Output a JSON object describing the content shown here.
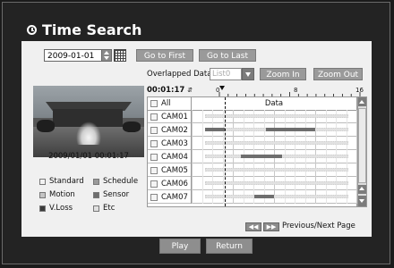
{
  "title": "Time Search",
  "date": {
    "value": "2009-01-01"
  },
  "buttons": {
    "go_first": "Go to First",
    "go_last": "Go to Last",
    "zoom_in": "Zoom In",
    "zoom_out": "Zoom Out",
    "play": "Play",
    "return": "Return"
  },
  "overlapped": {
    "label": "Overlapped Data",
    "selected": "List0"
  },
  "preview": {
    "timestamp": "2009/01/01  00:01:17"
  },
  "legend": [
    {
      "label": "Standard",
      "color": "#f2f2f2"
    },
    {
      "label": "Schedule",
      "color": "#9a9a9a"
    },
    {
      "label": "Motion",
      "color": "#c4c4c4"
    },
    {
      "label": "Sensor",
      "color": "#6e6e6e"
    },
    {
      "label": "V.Loss",
      "color": "#3a3a3a"
    },
    {
      "label": "Etc",
      "color": "#e0e0e0"
    }
  ],
  "timeline": {
    "current_time": "00:01:17",
    "ticks": [
      "0",
      "8",
      "16"
    ]
  },
  "table": {
    "all_label": "All",
    "data_header": "Data"
  },
  "cameras": [
    {
      "name": "CAM01",
      "segments": [
        [
          0.08,
          0.95
        ]
      ],
      "dark": []
    },
    {
      "name": "CAM02",
      "segments": [
        [
          0.08,
          0.95
        ]
      ],
      "dark": [
        [
          0.08,
          0.2
        ],
        [
          0.45,
          0.75
        ]
      ]
    },
    {
      "name": "CAM03",
      "segments": [
        [
          0.08,
          0.95
        ]
      ],
      "dark": []
    },
    {
      "name": "CAM04",
      "segments": [
        [
          0.08,
          0.95
        ]
      ],
      "dark": [
        [
          0.3,
          0.55
        ]
      ]
    },
    {
      "name": "CAM05",
      "segments": [
        [
          0.08,
          0.95
        ]
      ],
      "dark": []
    },
    {
      "name": "CAM06",
      "segments": [
        [
          0.08,
          0.95
        ]
      ],
      "dark": []
    },
    {
      "name": "CAM07",
      "segments": [
        [
          0.08,
          0.95
        ]
      ],
      "dark": [
        [
          0.38,
          0.5
        ]
      ]
    }
  ],
  "paging": {
    "prev": "◀◀",
    "next": "▶▶",
    "label": "Previous/Next Page"
  }
}
